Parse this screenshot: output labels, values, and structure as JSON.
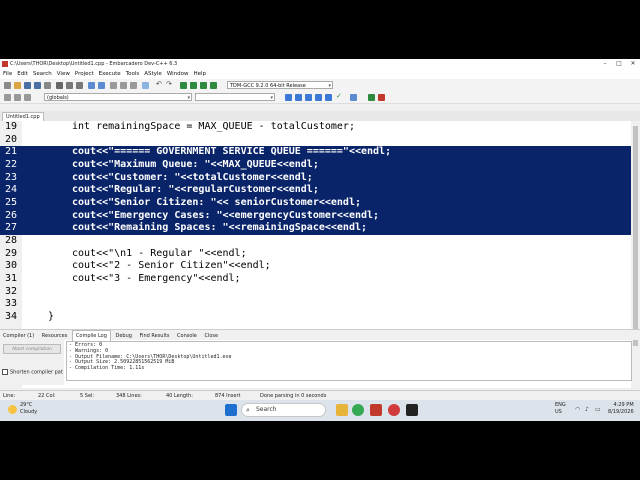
{
  "window": {
    "title": "C:\\Users\\THOR\\Desktop\\Untitled1.cpp - Embarcadero Dev-C++ 6.3"
  },
  "menu": [
    "File",
    "Edit",
    "Search",
    "View",
    "Project",
    "Execute",
    "Tools",
    "AStyle",
    "Window",
    "Help"
  ],
  "toolbar": {
    "compiler": "TDM-GCC 9.2.0 64-bit Release",
    "scope": "(globals)"
  },
  "file_tab": "Untitled1.cpp",
  "editor": {
    "lines": [
      {
        "num": "19",
        "code": "int remainingSpace = MAX_QUEUE - totalCustomer;",
        "selected": false
      },
      {
        "num": "20",
        "code": "",
        "selected": false
      },
      {
        "num": "21",
        "code": "cout<<\"====== GOVERNMENT SERVICE QUEUE ======\"<<endl;",
        "selected": true
      },
      {
        "num": "22",
        "code": "cout<<\"Maximum Queue: \"<<MAX_QUEUE<<endl;",
        "selected": true
      },
      {
        "num": "23",
        "code": "cout<<\"Customer: \"<<totalCustomer<<endl;",
        "selected": true
      },
      {
        "num": "24",
        "code": "cout<<\"Regular: \"<<regularCustomer<<endl;",
        "selected": true
      },
      {
        "num": "25",
        "code": "cout<<\"Senior Citizen: \"<< seniorCustomer<<endl;",
        "selected": true
      },
      {
        "num": "26",
        "code": "cout<<\"Emergency Cases: \"<<emergencyCustomer<<endl;",
        "selected": true
      },
      {
        "num": "27",
        "code": "cout<<\"Remaining Spaces: \"<<remainingSpace<<endl;",
        "selected": true
      },
      {
        "num": "28",
        "code": "",
        "selected": false
      },
      {
        "num": "29",
        "code": "cout<<\"\\n1 - Regular \"<<endl;",
        "selected": false
      },
      {
        "num": "30",
        "code": "cout<<\"2 - Senior Citizen\"<<endl;",
        "selected": false
      },
      {
        "num": "31",
        "code": "cout<<\"3 - Emergency\"<<endl;",
        "selected": false
      },
      {
        "num": "32",
        "code": "",
        "selected": false
      },
      {
        "num": "33",
        "code": "",
        "selected": false
      },
      {
        "num": "34",
        "code": "}",
        "selected": false
      }
    ]
  },
  "bottom_tabs": [
    "Compiler (1)",
    "Resources",
    "Compile Log",
    "Debug",
    "Find Results",
    "Console",
    "Close"
  ],
  "abort_label": "Abort compilation",
  "shorten_label": "Shorten compiler pat",
  "log": [
    "- Errors: 0",
    "- Warnings: 0",
    "- Output Filename: C:\\Users\\THOR\\Desktop\\Untitled1.exe",
    "- Output Size: 2.50922851562519 MiB",
    "- Compilation Time: 1.11s"
  ],
  "status": {
    "line": "Line:",
    "col": "22 Col:",
    "sel": "5 Sel:",
    "lines": "348 Lines:",
    "length": "40 Length:",
    "insert": "874 Insert",
    "msg": "Done parsing in 0 seconds"
  },
  "taskbar": {
    "temp": "29°C",
    "weather": "Cloudy",
    "search": "Search",
    "lang1": "ENG",
    "lang2": "US",
    "time": "4:29 PM",
    "date": "8/19/2026"
  },
  "colors": {
    "selection": "#0a246a",
    "background": "#ffffff",
    "gutter": "#f0f0f0"
  }
}
